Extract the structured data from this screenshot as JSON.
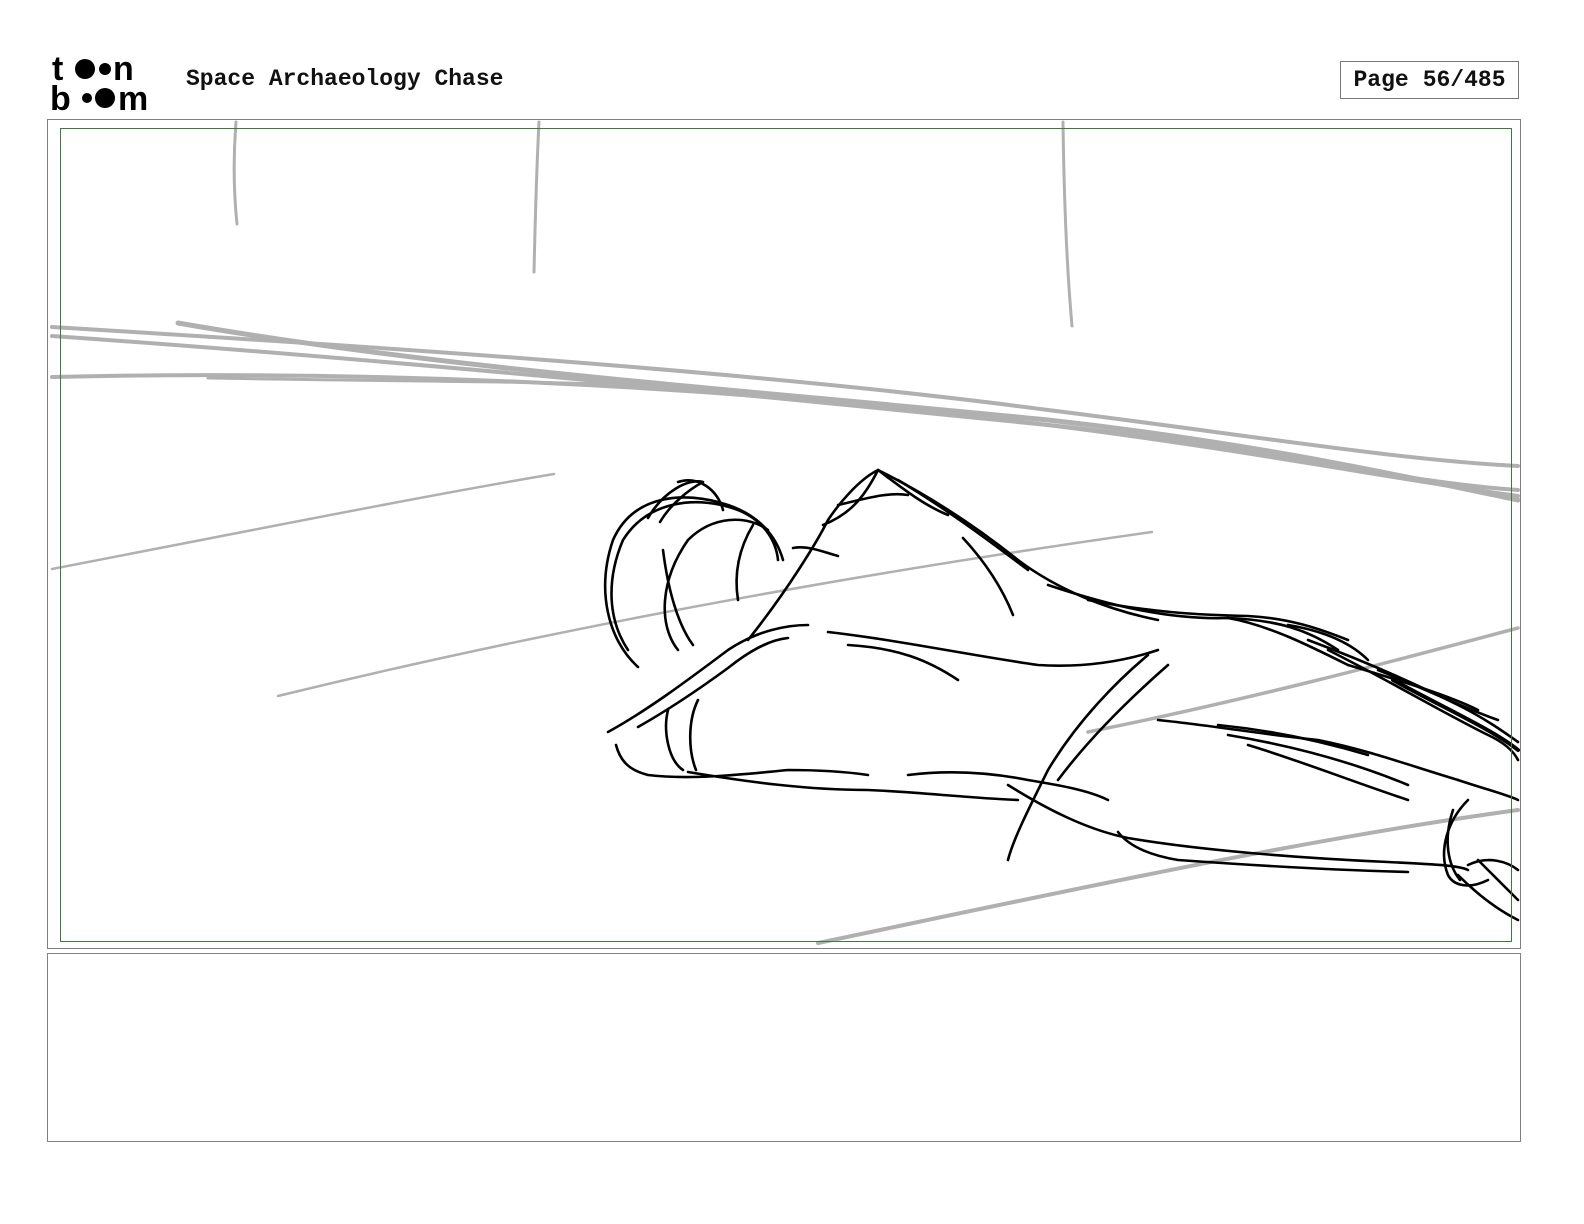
{
  "header": {
    "brand_top": "toon",
    "brand_bottom": "boom",
    "title": "Space Archaeology Chase",
    "page_label": "Page",
    "page_value": "56/485"
  },
  "panel": {
    "sketch_icon": "storyboard-sketch-figure-lying",
    "notes_text": ""
  },
  "colors": {
    "frame_green": "#3d7a3d",
    "border_gray": "#808080",
    "sketch_black": "#000000",
    "sketch_gray": "#b0b0b0"
  }
}
